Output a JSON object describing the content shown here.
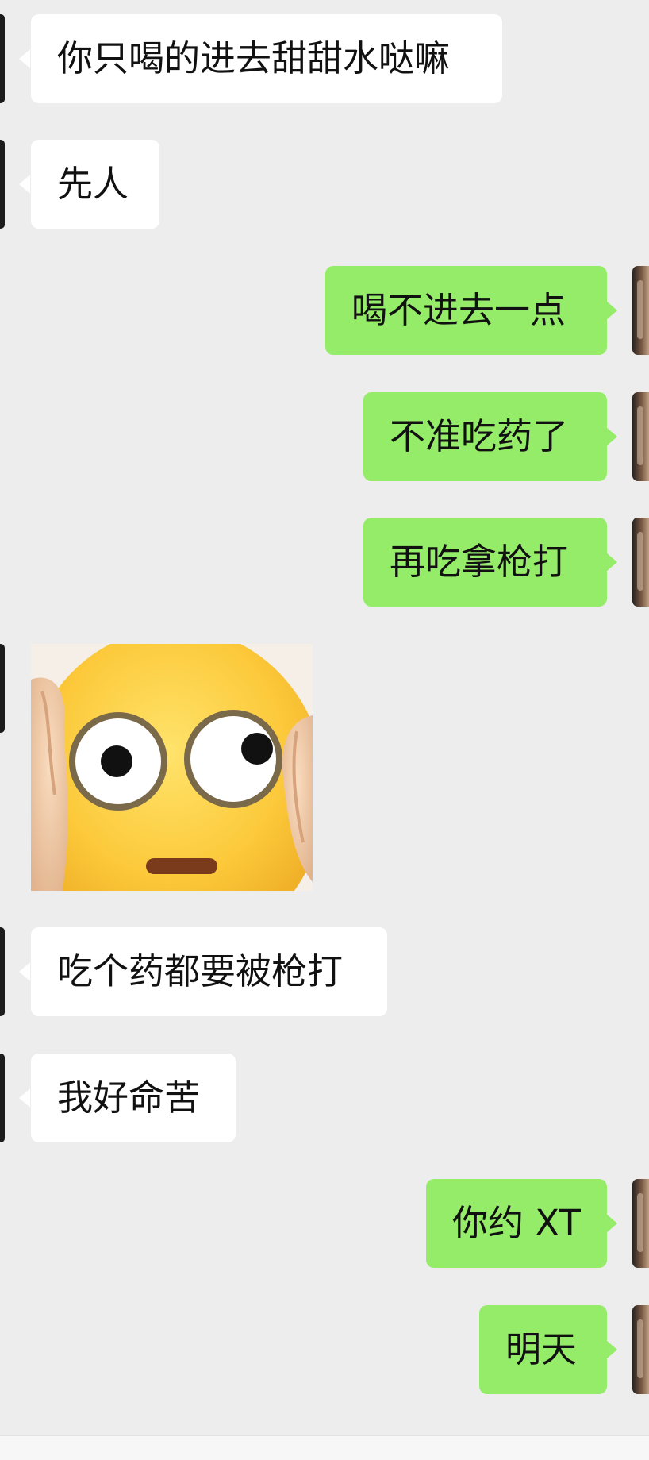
{
  "messages": [
    {
      "side": "in",
      "text": "你只喝的进去甜甜水哒嘛"
    },
    {
      "side": "in",
      "text": "先人"
    },
    {
      "side": "out",
      "text": "喝不进去一点"
    },
    {
      "side": "out",
      "text": "不准吃药了"
    },
    {
      "side": "out",
      "text": "再吃拿枪打"
    },
    {
      "side": "in",
      "type": "sticker",
      "icon": "flushed-face-covering-ears-emoji"
    },
    {
      "side": "in",
      "text": "吃个药都要被枪打"
    },
    {
      "side": "in",
      "text": "我好命苦"
    },
    {
      "side": "out",
      "text": "你约 XT"
    },
    {
      "side": "out",
      "text": "明天"
    }
  ],
  "colors": {
    "background": "#ededed",
    "incoming_bubble": "#ffffff",
    "outgoing_bubble": "#95ec69",
    "text": "#111111"
  }
}
